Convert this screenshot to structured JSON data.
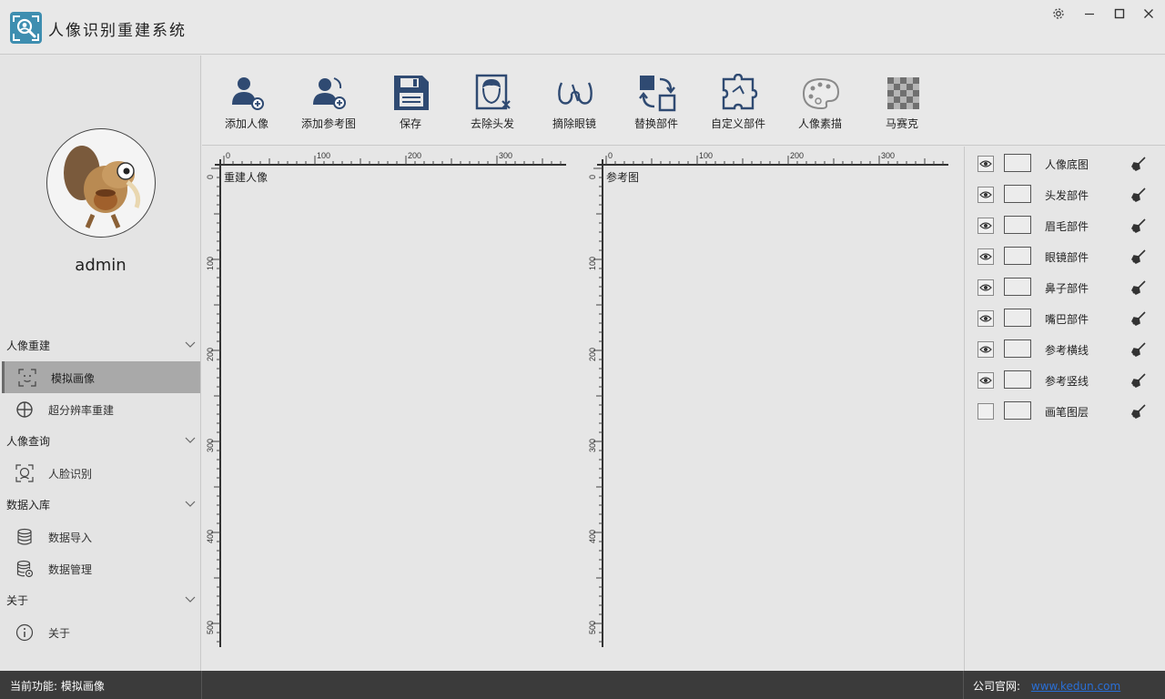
{
  "app": {
    "title": "人像识别重建系统"
  },
  "window_controls": {
    "settings_icon": "gear-icon",
    "minimize_icon": "minimize-icon",
    "maximize_icon": "maximize-icon",
    "close_icon": "close-icon"
  },
  "user": {
    "name": "admin"
  },
  "sidebar": {
    "groups": [
      {
        "label": "人像重建",
        "items": [
          {
            "label": "模拟画像",
            "icon": "face-scan-icon",
            "active": true
          },
          {
            "label": "超分辨率重建",
            "icon": "crosshair-circle-icon",
            "active": false
          }
        ]
      },
      {
        "label": "人像查询",
        "items": [
          {
            "label": "人脸识别",
            "icon": "face-recognition-icon",
            "active": false
          }
        ]
      },
      {
        "label": "数据入库",
        "items": [
          {
            "label": "数据导入",
            "icon": "database-icon",
            "active": false
          },
          {
            "label": "数据管理",
            "icon": "database-settings-icon",
            "active": false
          }
        ]
      },
      {
        "label": "关于",
        "items": [
          {
            "label": "关于",
            "icon": "info-icon",
            "active": false
          }
        ]
      }
    ]
  },
  "toolbar": {
    "buttons": [
      {
        "label": "添加人像",
        "icon": "add-person-icon"
      },
      {
        "label": "添加参考图",
        "icon": "add-reference-icon"
      },
      {
        "label": "保存",
        "icon": "save-icon"
      },
      {
        "label": "去除头发",
        "icon": "remove-hair-icon"
      },
      {
        "label": "摘除眼镜",
        "icon": "remove-glasses-icon"
      },
      {
        "label": "替换部件",
        "icon": "replace-part-icon"
      },
      {
        "label": "自定义部件",
        "icon": "puzzle-icon"
      },
      {
        "label": "人像素描",
        "icon": "palette-icon"
      },
      {
        "label": "马赛克",
        "icon": "mosaic-icon"
      }
    ]
  },
  "panels": {
    "left": {
      "label": "重建人像",
      "h_ticks": [
        "0",
        "100",
        "200",
        "300"
      ],
      "v_ticks": [
        "0",
        "100",
        "200",
        "300",
        "400",
        "500"
      ]
    },
    "right": {
      "label": "参考图",
      "h_ticks": [
        "0",
        "100",
        "200",
        "300"
      ],
      "v_ticks": [
        "0",
        "100",
        "200",
        "300",
        "400",
        "500"
      ]
    }
  },
  "layers": [
    {
      "name": "人像底图",
      "visible": true
    },
    {
      "name": "头发部件",
      "visible": true
    },
    {
      "name": "眉毛部件",
      "visible": true
    },
    {
      "name": "眼镜部件",
      "visible": true
    },
    {
      "name": "鼻子部件",
      "visible": true
    },
    {
      "name": "嘴巴部件",
      "visible": true
    },
    {
      "name": "参考横线",
      "visible": true
    },
    {
      "name": "参考竖线",
      "visible": true
    },
    {
      "name": "画笔图层",
      "visible": false
    }
  ],
  "status": {
    "current_label": "当前功能:",
    "current_value": "模拟画像",
    "company_label": "公司官网:",
    "company_url": "www.kedun.com"
  },
  "colors": {
    "icon_blue": "#2f4a72",
    "active_menu": "#a9a9a9",
    "status_bg": "#3b3b3b",
    "link": "#2a6fd6"
  }
}
